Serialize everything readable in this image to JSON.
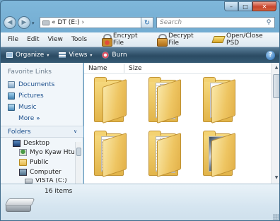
{
  "titlebar": {
    "minimize": "–",
    "maximize": "□",
    "close": "✕"
  },
  "nav": {
    "back_icon": "back-arrow-icon",
    "forward_icon": "forward-arrow-icon"
  },
  "address": {
    "prefix": "«",
    "path": "DT (E:)",
    "chevron": "›",
    "dropdown": "▾"
  },
  "refresh": "↻",
  "search": {
    "placeholder": "Search",
    "icon": "⚲"
  },
  "menu": [
    "File",
    "Edit",
    "View",
    "Tools"
  ],
  "plugins": {
    "encrypt": "Encrypt File",
    "decrypt": "Decrypt File",
    "openclose": "Open/Close PSD"
  },
  "commands": {
    "organize": "Organize",
    "views": "Views",
    "burn": "Burn",
    "dropdown": "▾",
    "help": "?"
  },
  "navpane": {
    "heading": "Favorite Links",
    "favorites": [
      "Documents",
      "Pictures",
      "Music"
    ],
    "more": "More",
    "more_glyph": "»",
    "folders_label": "Folders",
    "collapse_glyph": "∨",
    "tree": [
      "Desktop",
      "Myo Kyaw Htun",
      "Public",
      "Computer",
      "VISTA (C:)"
    ]
  },
  "filelist": {
    "columns": [
      "Name",
      "Size"
    ],
    "scroll_up": "▲",
    "scroll_down": "▼"
  },
  "status": {
    "item_count": "16 items"
  },
  "colors": {
    "chrome_blue": "#6fa6c9",
    "command_bar": "#2b4b63",
    "link_blue": "#1c4f8c",
    "folder_yellow": "#e2b449"
  }
}
